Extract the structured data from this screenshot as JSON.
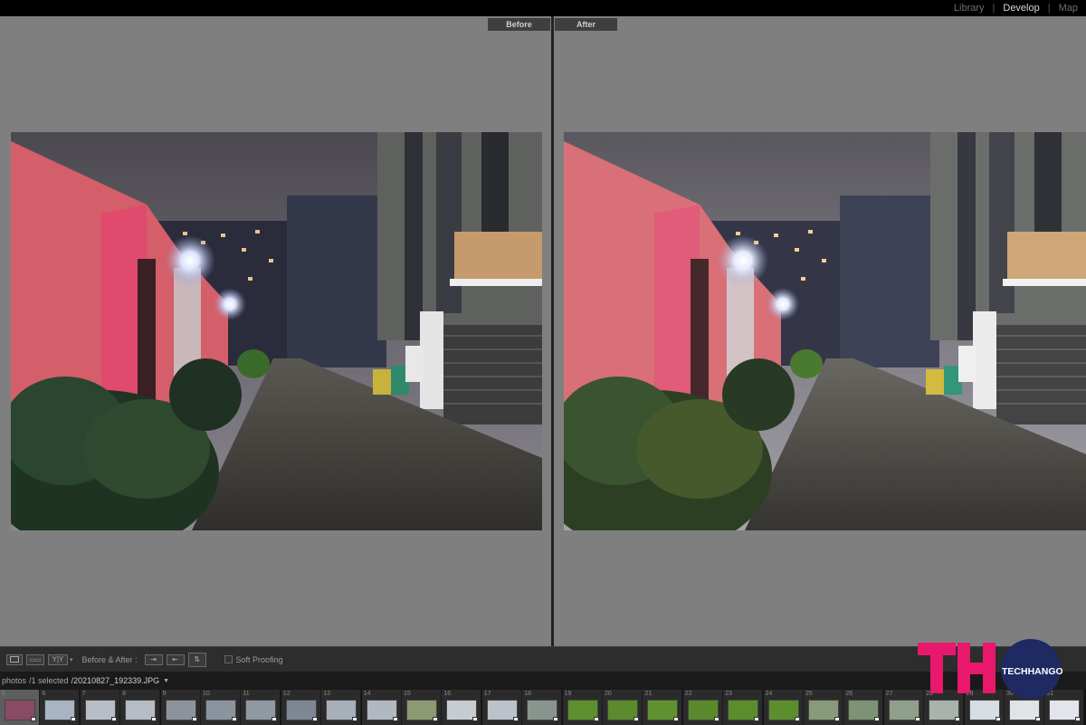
{
  "modules": [
    {
      "label": "Library",
      "active": false
    },
    {
      "label": "Develop",
      "active": true
    },
    {
      "label": "Map",
      "active": false
    }
  ],
  "compare": {
    "before_label": "Before",
    "after_label": "After"
  },
  "toolbar": {
    "view_yy": "Y|Y",
    "before_after_label": "Before & After :",
    "soft_proofing_label": "Soft Proofing"
  },
  "filmstrip": {
    "photos_label": "photos",
    "selected_label": "/1 selected",
    "filename": "/20210827_192339.JPG",
    "items": [
      {
        "num": "5",
        "selected": true,
        "color": "#8a4a63"
      },
      {
        "num": "6",
        "selected": false,
        "color": "#a9b4c2"
      },
      {
        "num": "7",
        "selected": false,
        "color": "#b8bec6"
      },
      {
        "num": "8",
        "selected": false,
        "color": "#b5bcc4"
      },
      {
        "num": "9",
        "selected": false,
        "color": "#8d939b"
      },
      {
        "num": "10",
        "selected": false,
        "color": "#8b939e"
      },
      {
        "num": "11",
        "selected": false,
        "color": "#9098a2"
      },
      {
        "num": "12",
        "selected": false,
        "color": "#7f8892"
      },
      {
        "num": "13",
        "selected": false,
        "color": "#a7afb9"
      },
      {
        "num": "14",
        "selected": false,
        "color": "#b2b8c0"
      },
      {
        "num": "15",
        "selected": false,
        "color": "#8c9a73"
      },
      {
        "num": "16",
        "selected": false,
        "color": "#c6ccd2"
      },
      {
        "num": "17",
        "selected": false,
        "color": "#bcc2ca"
      },
      {
        "num": "18",
        "selected": false,
        "color": "#8a948f"
      },
      {
        "num": "19",
        "selected": false,
        "color": "#5e8f2e"
      },
      {
        "num": "20",
        "selected": false,
        "color": "#5b8b2c"
      },
      {
        "num": "21",
        "selected": false,
        "color": "#5f922f"
      },
      {
        "num": "22",
        "selected": false,
        "color": "#5a8a2b"
      },
      {
        "num": "23",
        "selected": false,
        "color": "#5c8d2d"
      },
      {
        "num": "24",
        "selected": false,
        "color": "#5d8e2e"
      },
      {
        "num": "25",
        "selected": false,
        "color": "#879a7a"
      },
      {
        "num": "26",
        "selected": false,
        "color": "#7d9374"
      },
      {
        "num": "27",
        "selected": false,
        "color": "#8fa08a"
      },
      {
        "num": "28",
        "selected": false,
        "color": "#a7b3ab"
      },
      {
        "num": "29",
        "selected": false,
        "color": "#d7dde2"
      },
      {
        "num": "30",
        "selected": false,
        "color": "#dfe4e9"
      },
      {
        "num": "31",
        "selected": false,
        "color": "#e2e6ea"
      }
    ]
  },
  "watermark": {
    "letters": "TH",
    "brand": "TECHHANGOUT",
    "pink": "#e8186c",
    "navy": "#1f2a63"
  }
}
